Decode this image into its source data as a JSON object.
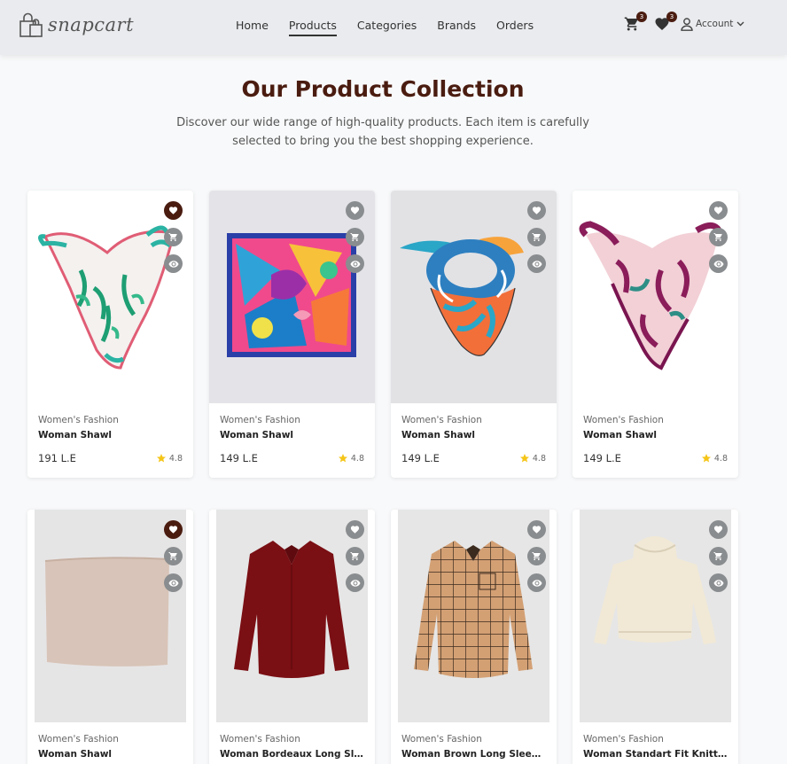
{
  "brand": {
    "name": "snapcart"
  },
  "nav": {
    "links": [
      {
        "label": "Home",
        "active": false
      },
      {
        "label": "Products",
        "active": true
      },
      {
        "label": "Categories",
        "active": false
      },
      {
        "label": "Brands",
        "active": false
      },
      {
        "label": "Orders",
        "active": false
      }
    ],
    "cart_count": "3",
    "wishlist_count": "3",
    "account_label": "Account",
    "icons": [
      "cart-icon",
      "heart-icon",
      "user-icon",
      "chevron-down-icon"
    ]
  },
  "hero": {
    "title": "Our Product Collection",
    "subtitle": "Discover our wide range of high-quality products. Each item is carefully selected to bring you the best shopping experience."
  },
  "colors": {
    "accent": "#4a1c10",
    "action_gray": "#8a8d8f",
    "star": "#f5c518"
  },
  "products": [
    {
      "category": "Women's Fashion",
      "name": "Woman Shawl",
      "price": "191 L.E",
      "rating": "4.8",
      "wishlisted": true
    },
    {
      "category": "Women's Fashion",
      "name": "Woman Shawl",
      "price": "149 L.E",
      "rating": "4.8",
      "wishlisted": false
    },
    {
      "category": "Women's Fashion",
      "name": "Woman Shawl",
      "price": "149 L.E",
      "rating": "4.8",
      "wishlisted": false
    },
    {
      "category": "Women's Fashion",
      "name": "Woman Shawl",
      "price": "149 L.E",
      "rating": "4.8",
      "wishlisted": false
    },
    {
      "category": "Women's Fashion",
      "name": "Woman Shawl",
      "price": "",
      "rating": "",
      "wishlisted": true
    },
    {
      "category": "Women's Fashion",
      "name": "Woman Bordeaux Long Sleeve...",
      "price": "",
      "rating": "",
      "wishlisted": false
    },
    {
      "category": "Women's Fashion",
      "name": "Woman Brown Long Sleeve...",
      "price": "",
      "rating": "",
      "wishlisted": false
    },
    {
      "category": "Women's Fashion",
      "name": "Woman Standart Fit Knitted...",
      "price": "",
      "rating": "",
      "wishlisted": false
    }
  ]
}
